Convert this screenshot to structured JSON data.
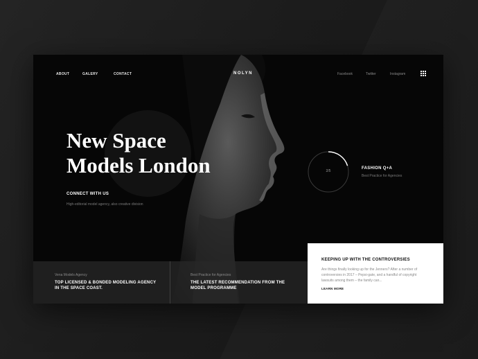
{
  "nav": {
    "about": "ABOUT",
    "galery": "GALERY",
    "contact": "CONTACT",
    "logo": "NOLYN",
    "facebook": "Facebook",
    "twitter": "Twitter",
    "instagram": "Instagram",
    "menu_icon": "grid-icon"
  },
  "hero": {
    "title_line1": "New Space",
    "title_line2": "Models London",
    "connect": "CONNECT WITH US",
    "connect_sub": "High-editorial model agency, also creative division"
  },
  "slider": {
    "counter": "2/5",
    "progress": 0.2,
    "title": "FASHION Q+A",
    "subtitle": "Best Practice for Agencies"
  },
  "cards": [
    {
      "kicker": "Vena Models Agency",
      "title": "TOP LICENSED & BONDED MODELING AGENCY IN THE SPACE COAST."
    },
    {
      "kicker": "Best Practice for Agencies",
      "title": "THE LATEST RECOMMENDATION FROM THE MODEL PROGRAMME"
    }
  ],
  "feature": {
    "title": "KEEPING UP WITH THE CONTROVERSIES",
    "body": "Are things finally looking up for the Jenners? After a number of controversies in 2017 – Pepsi-gate, and a handful of copyright lawsuits among them – the family can...",
    "link": "LEARN MORE"
  },
  "colors": {
    "background": "#1b1b1b",
    "panel": "#060606",
    "accent": "#ffffff"
  }
}
